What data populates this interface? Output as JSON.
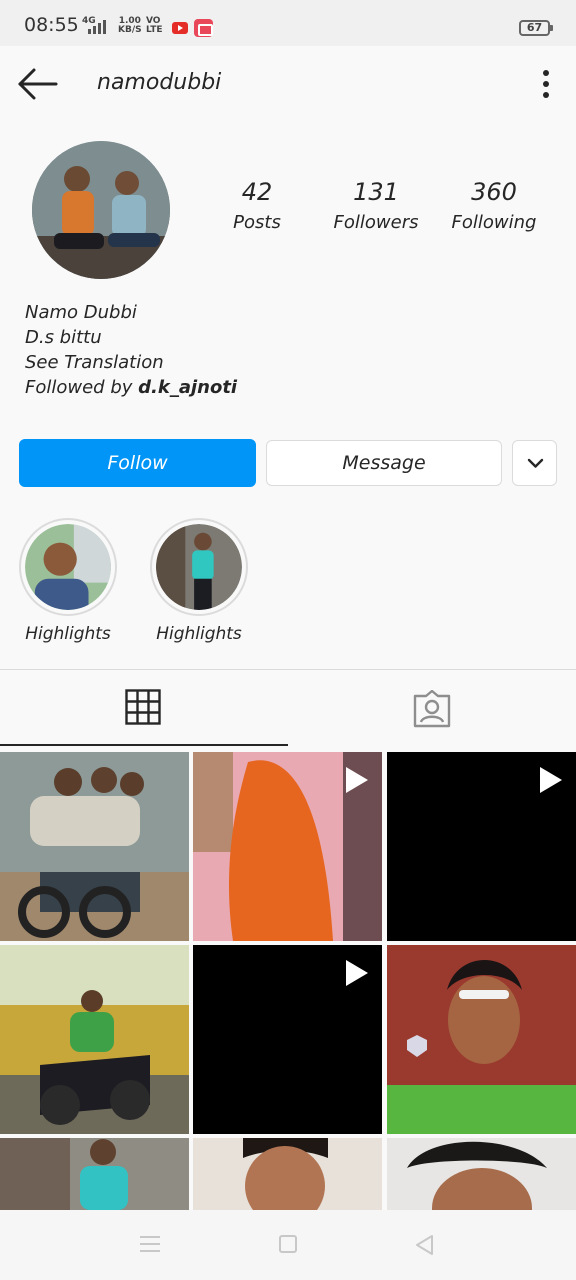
{
  "status_bar": {
    "time": "08:55",
    "network": "4G",
    "speed_value": "1.00",
    "speed_unit": "KB/S",
    "volte_top": "VO",
    "volte_bottom": "LTE",
    "battery": "67"
  },
  "header": {
    "username": "namodubbi"
  },
  "profile": {
    "stats": [
      {
        "value": "42",
        "label": "Posts"
      },
      {
        "value": "131",
        "label": "Followers"
      },
      {
        "value": "360",
        "label": "Following"
      }
    ],
    "bio": {
      "name": "Namo Dubbi",
      "line2": "D.s bittu",
      "translation": "See Translation",
      "followed_by_prefix": "Followed by ",
      "followed_by_user": "d.k_ajnoti"
    }
  },
  "actions": {
    "follow": "Follow",
    "message": "Message"
  },
  "highlights": [
    {
      "label": "Highlights"
    },
    {
      "label": "Highlights"
    }
  ],
  "tabs": [
    {
      "icon": "grid-icon",
      "active": true
    },
    {
      "icon": "tagged-icon",
      "active": false
    }
  ],
  "posts": [
    {
      "type": "photo"
    },
    {
      "type": "video"
    },
    {
      "type": "video"
    },
    {
      "type": "photo"
    },
    {
      "type": "video"
    },
    {
      "type": "photo"
    },
    {
      "type": "photo"
    },
    {
      "type": "photo"
    },
    {
      "type": "photo"
    }
  ],
  "colors": {
    "accent": "#0095f6",
    "text": "#262626",
    "border": "#dbdbdb",
    "background": "#f9f9f9"
  },
  "navbar": {
    "icons": [
      "menu-icon",
      "home-icon",
      "back-nav-icon"
    ]
  }
}
